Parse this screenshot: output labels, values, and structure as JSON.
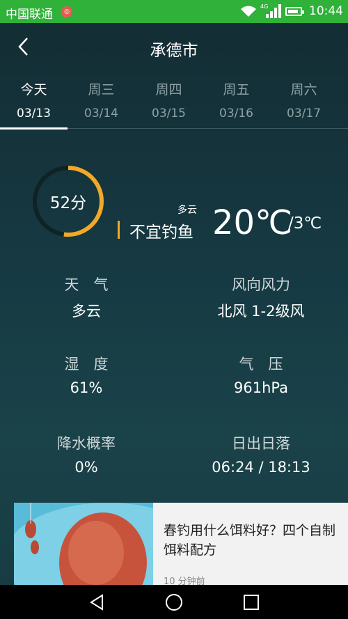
{
  "status_bar": {
    "carrier": "中国联通",
    "network": "4G",
    "time": "10:44"
  },
  "header": {
    "title": "承德市"
  },
  "tabs": [
    {
      "day": "今天",
      "date": "03/13"
    },
    {
      "day": "周三",
      "date": "03/14"
    },
    {
      "day": "周四",
      "date": "03/15"
    },
    {
      "day": "周五",
      "date": "03/16"
    },
    {
      "day": "周六",
      "date": "03/17"
    }
  ],
  "summary": {
    "score": "52分",
    "score_value": 52,
    "advice": "不宜钓鱼",
    "condition": "多云",
    "temp_high": "20℃",
    "temp_low": "/3℃",
    "colors": {
      "gauge": "#f2a928",
      "gauge_track": "#0f2226"
    }
  },
  "details": [
    {
      "label": "天　气",
      "value": "多云"
    },
    {
      "label": "风向风力",
      "value": "北风 1-2级风"
    },
    {
      "label": "湿　度",
      "value": "61%"
    },
    {
      "label": "气　压",
      "value": "961hPa"
    },
    {
      "label": "降水概率",
      "value": "0%"
    },
    {
      "label": "日出日落",
      "value": "06:24 / 18:13"
    }
  ],
  "article": {
    "title": "春钓用什么饵料好？四个自制饵料配方",
    "meta": "10 分钟前"
  },
  "icons": {
    "back": "chevron-left-icon",
    "nav_back": "triangle-back-icon",
    "nav_home": "circle-home-icon",
    "nav_recent": "square-recent-icon"
  }
}
